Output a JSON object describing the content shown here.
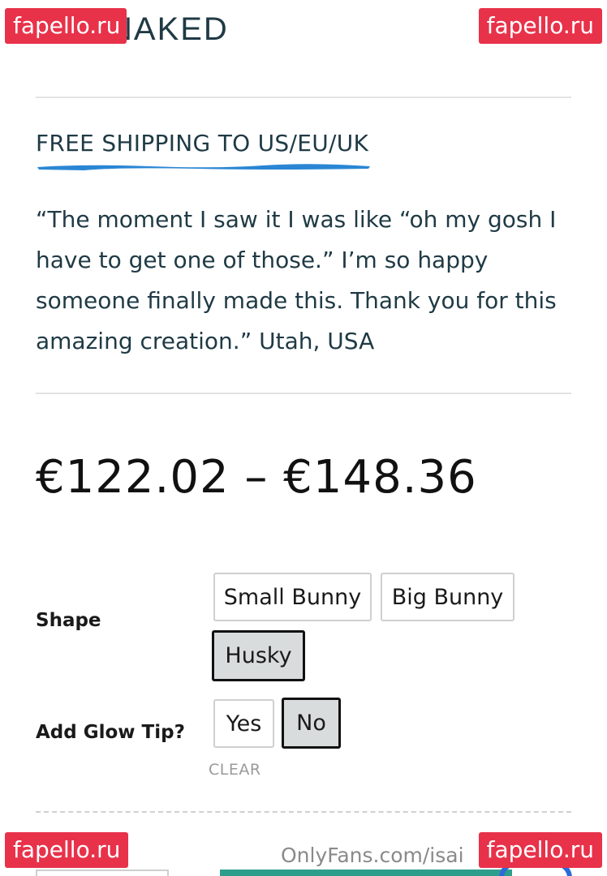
{
  "header": {
    "logo_text": "NAKED"
  },
  "watermarks": {
    "tl": "fapello.ru",
    "tr": "fapello.ru",
    "bl": "fapello.ru",
    "br": "fapello.ru"
  },
  "banner": {
    "shipping_text": "FREE SHIPPING TO US/EU/UK",
    "underline_color": "#2a86d4"
  },
  "testimonial": {
    "text": "“The moment I saw it I was like “oh my gosh I have to get one of those.” I’m so happy someone finally made this. Thank you for this amazing creation.” Utah, USA"
  },
  "product": {
    "price_range": "€122.02 – €148.36"
  },
  "variations": {
    "shape": {
      "label": "Shape",
      "options": [
        "Small Bunny",
        "Big Bunny",
        "Husky"
      ],
      "selected": "Husky"
    },
    "glow_tip": {
      "label": "Add Glow Tip?",
      "options": [
        "Yes",
        "No"
      ],
      "selected": "No"
    },
    "clear_label": "CLEAR"
  },
  "footer": {
    "onlyfans_text": "OnlyFans.com/isai"
  },
  "colors": {
    "text": "#1f3a45",
    "selected_bg": "#d9dcdc",
    "watermark": "#e8324a",
    "teal": "#2e9e8c"
  }
}
